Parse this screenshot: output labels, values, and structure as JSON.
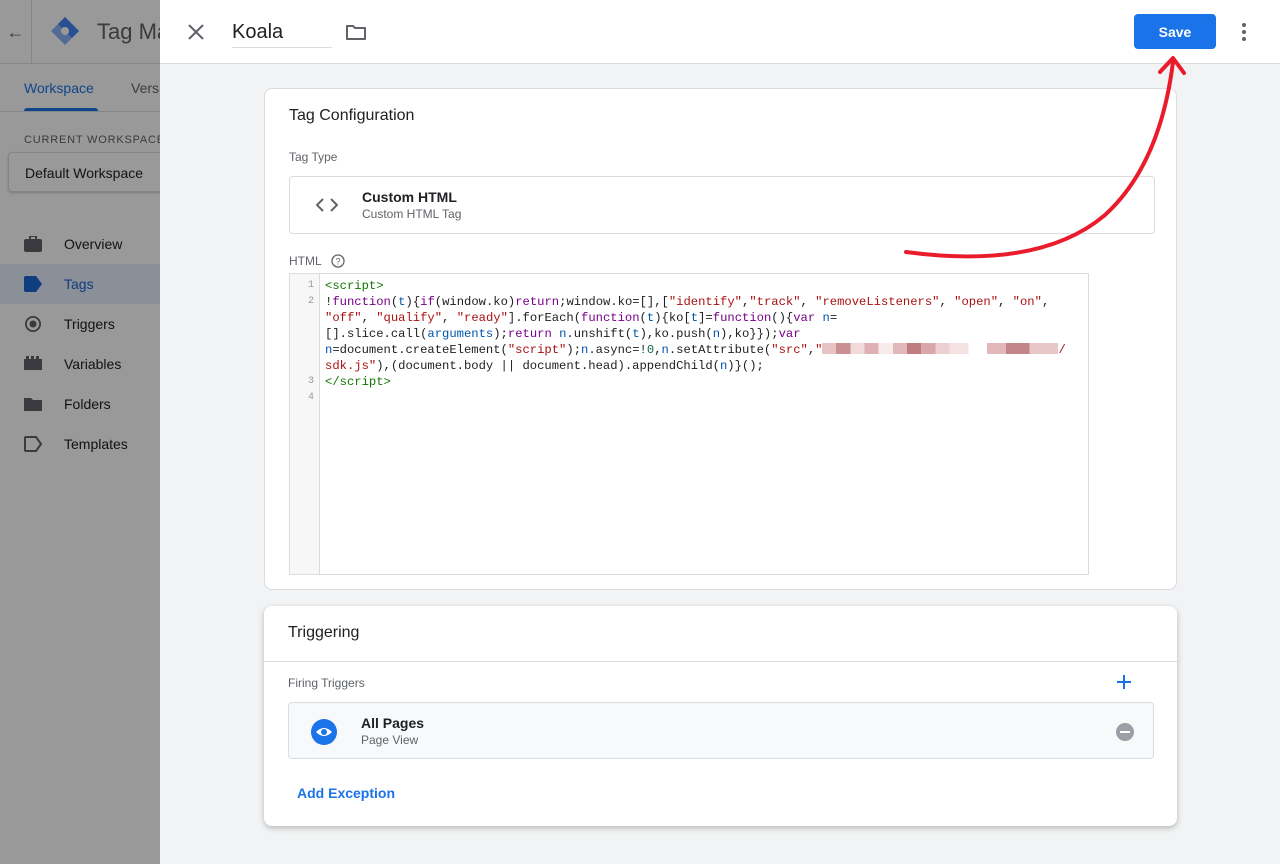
{
  "background_app": {
    "title": "Tag Ma",
    "tabs": [
      "Workspace",
      "Vers"
    ],
    "current_workspace_label": "CURRENT WORKSPACE",
    "workspace_name": "Default Workspace",
    "nav": [
      "Overview",
      "Tags",
      "Triggers",
      "Variables",
      "Folders",
      "Templates"
    ],
    "active_nav": "Tags"
  },
  "header": {
    "tag_name": "Koala",
    "save_label": "Save"
  },
  "tag_config": {
    "title": "Tag Configuration",
    "type_label": "Tag Type",
    "type_name": "Custom HTML",
    "type_sub": "Custom HTML Tag",
    "html_label": "HTML",
    "line_numbers": [
      "1",
      "2",
      "3",
      "4"
    ]
  },
  "triggering": {
    "title": "Triggering",
    "firing_label": "Firing Triggers",
    "trigger_name": "All Pages",
    "trigger_sub": "Page View",
    "add_exception": "Add Exception"
  },
  "colors": {
    "accent": "#1a73e8",
    "annotation": "#ea1c2c"
  }
}
